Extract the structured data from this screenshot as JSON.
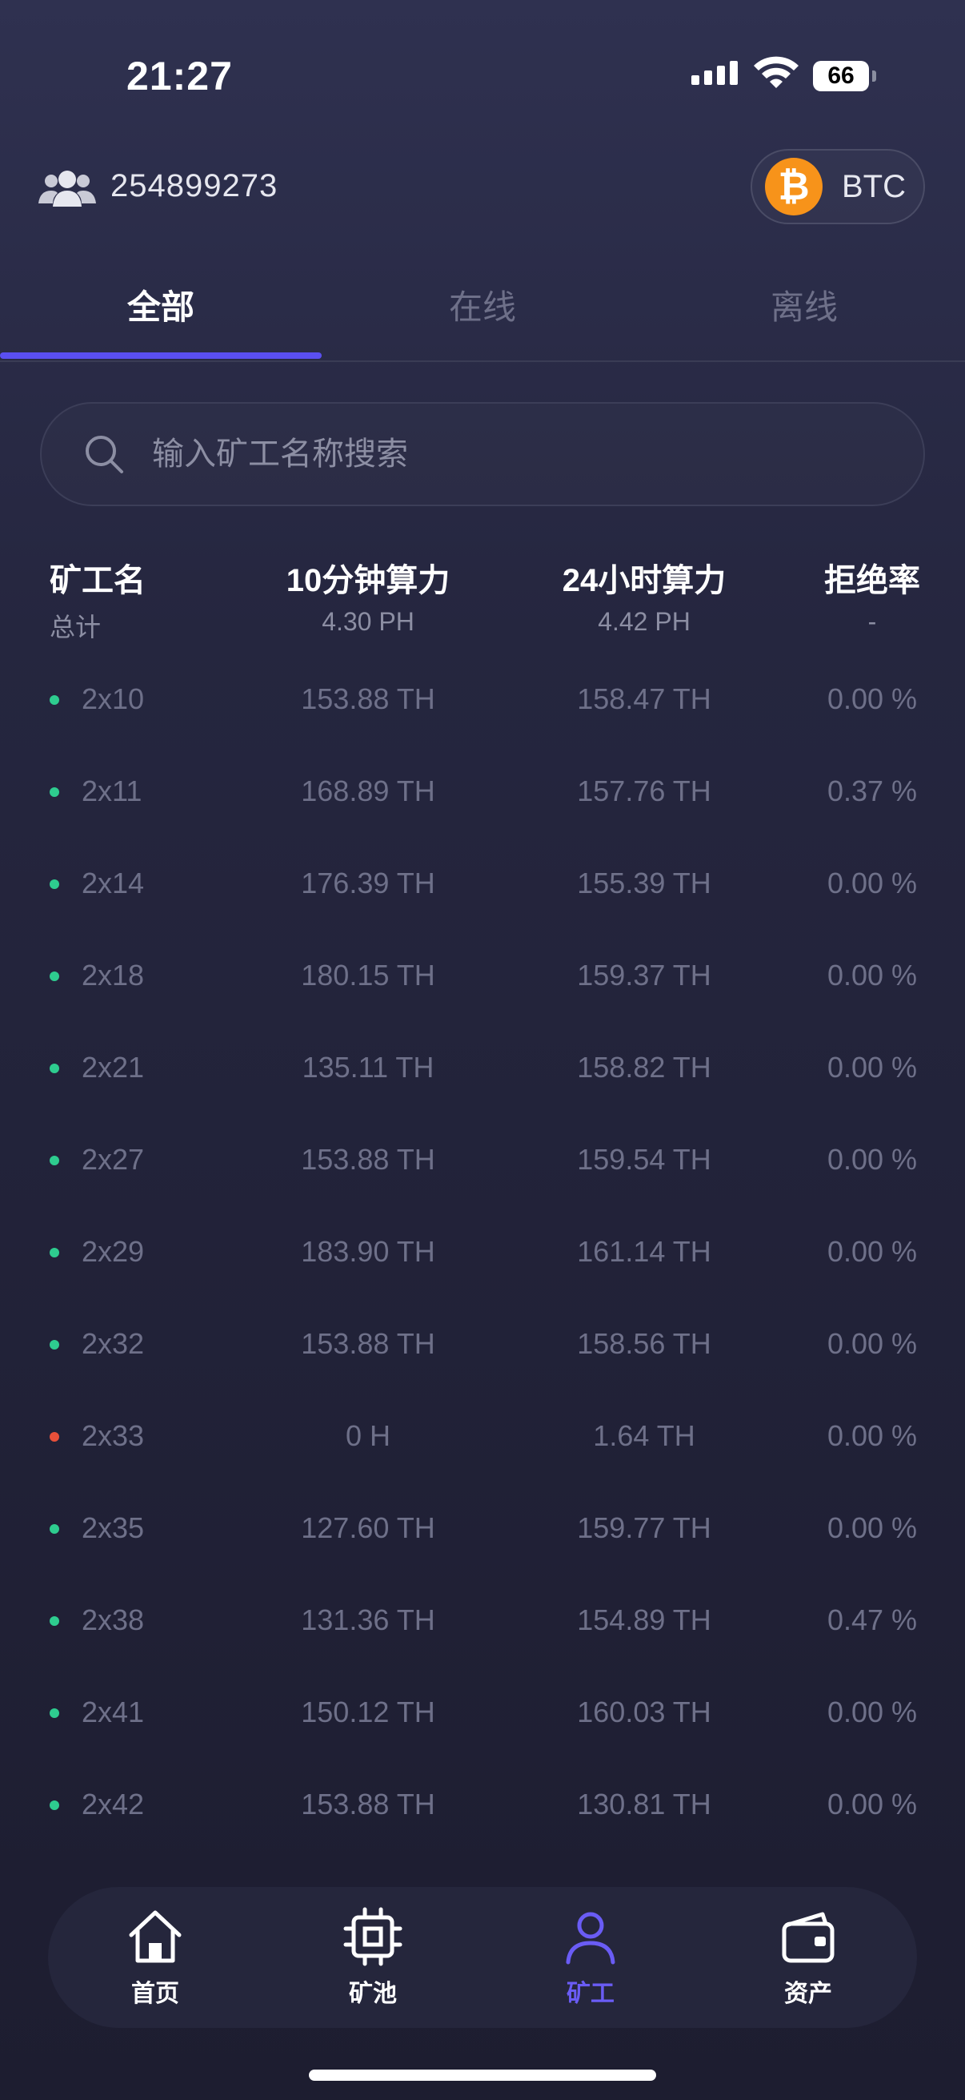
{
  "status_bar": {
    "time": "21:27",
    "battery": "66"
  },
  "header": {
    "account_id": "254899273",
    "coin_label": "BTC",
    "coin_icon": "bitcoin-icon"
  },
  "tabs": [
    {
      "label": "全部",
      "active": true
    },
    {
      "label": "在线",
      "active": false
    },
    {
      "label": "离线",
      "active": false
    }
  ],
  "search": {
    "placeholder": "输入矿工名称搜索",
    "value": ""
  },
  "table": {
    "headers": [
      "矿工名",
      "10分钟算力",
      "24小时算力",
      "拒绝率"
    ],
    "totals": [
      "总计",
      "4.30 PH",
      "4.42 PH",
      "-"
    ],
    "rows": [
      {
        "name": "2x10",
        "h10m": "153.88 TH",
        "h24h": "158.47 TH",
        "reject": "0.00 %",
        "status": "online"
      },
      {
        "name": "2x11",
        "h10m": "168.89 TH",
        "h24h": "157.76 TH",
        "reject": "0.37 %",
        "status": "online"
      },
      {
        "name": "2x14",
        "h10m": "176.39 TH",
        "h24h": "155.39 TH",
        "reject": "0.00 %",
        "status": "online"
      },
      {
        "name": "2x18",
        "h10m": "180.15 TH",
        "h24h": "159.37 TH",
        "reject": "0.00 %",
        "status": "online"
      },
      {
        "name": "2x21",
        "h10m": "135.11 TH",
        "h24h": "158.82 TH",
        "reject": "0.00 %",
        "status": "online"
      },
      {
        "name": "2x27",
        "h10m": "153.88 TH",
        "h24h": "159.54 TH",
        "reject": "0.00 %",
        "status": "online"
      },
      {
        "name": "2x29",
        "h10m": "183.90 TH",
        "h24h": "161.14 TH",
        "reject": "0.00 %",
        "status": "online"
      },
      {
        "name": "2x32",
        "h10m": "153.88 TH",
        "h24h": "158.56 TH",
        "reject": "0.00 %",
        "status": "online"
      },
      {
        "name": "2x33",
        "h10m": "0 H",
        "h24h": "1.64 TH",
        "reject": "0.00 %",
        "status": "offline"
      },
      {
        "name": "2x35",
        "h10m": "127.60 TH",
        "h24h": "159.77 TH",
        "reject": "0.00 %",
        "status": "online"
      },
      {
        "name": "2x38",
        "h10m": "131.36 TH",
        "h24h": "154.89 TH",
        "reject": "0.47 %",
        "status": "online"
      },
      {
        "name": "2x41",
        "h10m": "150.12 TH",
        "h24h": "160.03 TH",
        "reject": "0.00 %",
        "status": "online"
      },
      {
        "name": "2x42",
        "h10m": "153.88 TH",
        "h24h": "130.81 TH",
        "reject": "0.00 %",
        "status": "online"
      }
    ]
  },
  "nav": [
    {
      "label": "首页",
      "icon": "home-icon",
      "active": false
    },
    {
      "label": "矿池",
      "icon": "chip-icon",
      "active": false
    },
    {
      "label": "矿工",
      "icon": "user-icon",
      "active": true
    },
    {
      "label": "资产",
      "icon": "wallet-icon",
      "active": false
    }
  ],
  "colors": {
    "accent": "#5a4ff0",
    "online": "#2ecc8f",
    "offline": "#e8503a",
    "bitcoin": "#f7931a"
  }
}
